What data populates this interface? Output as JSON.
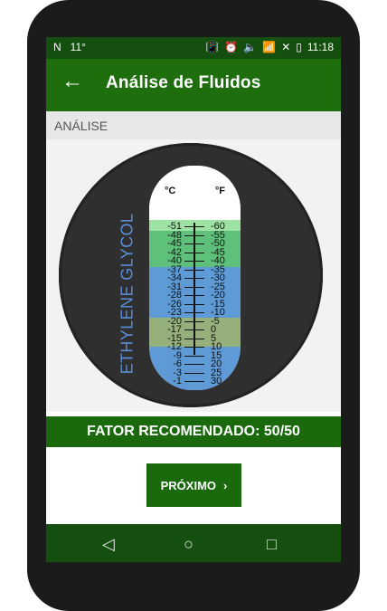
{
  "statusbar": {
    "left": [
      "N",
      "11°"
    ],
    "time": "11:18"
  },
  "appbar": {
    "title": "Análise de Fluidos"
  },
  "section": {
    "title": "ANÁLISE"
  },
  "chart": {
    "label": "ETHYLENE GLYCOL",
    "unit_c": "°C",
    "unit_f": "°F",
    "left_scale": [
      "-51",
      "-48",
      "-45",
      "-42",
      "-40",
      "-37",
      "-34",
      "-31",
      "-28",
      "-26",
      "-23",
      "-20",
      "-17",
      "-15",
      "-12",
      "-9",
      "-6",
      "-3",
      "-1"
    ],
    "right_scale": [
      "-60",
      "-55",
      "-50",
      "-45",
      "-40",
      "-35",
      "-30",
      "-25",
      "-20",
      "-15",
      "-10",
      "-5",
      "0",
      "5",
      "10",
      "15",
      "20",
      "25",
      "30"
    ]
  },
  "recommendation": {
    "text": "FATOR RECOMENDADO: 50/50"
  },
  "actions": {
    "next": "PRÓXIMO"
  },
  "colors": {
    "primary": "#1e6e0e",
    "dark": "#154f0f",
    "blue": "#5d9ad6",
    "green": "#5ec07a",
    "olive": "#95b07a"
  }
}
